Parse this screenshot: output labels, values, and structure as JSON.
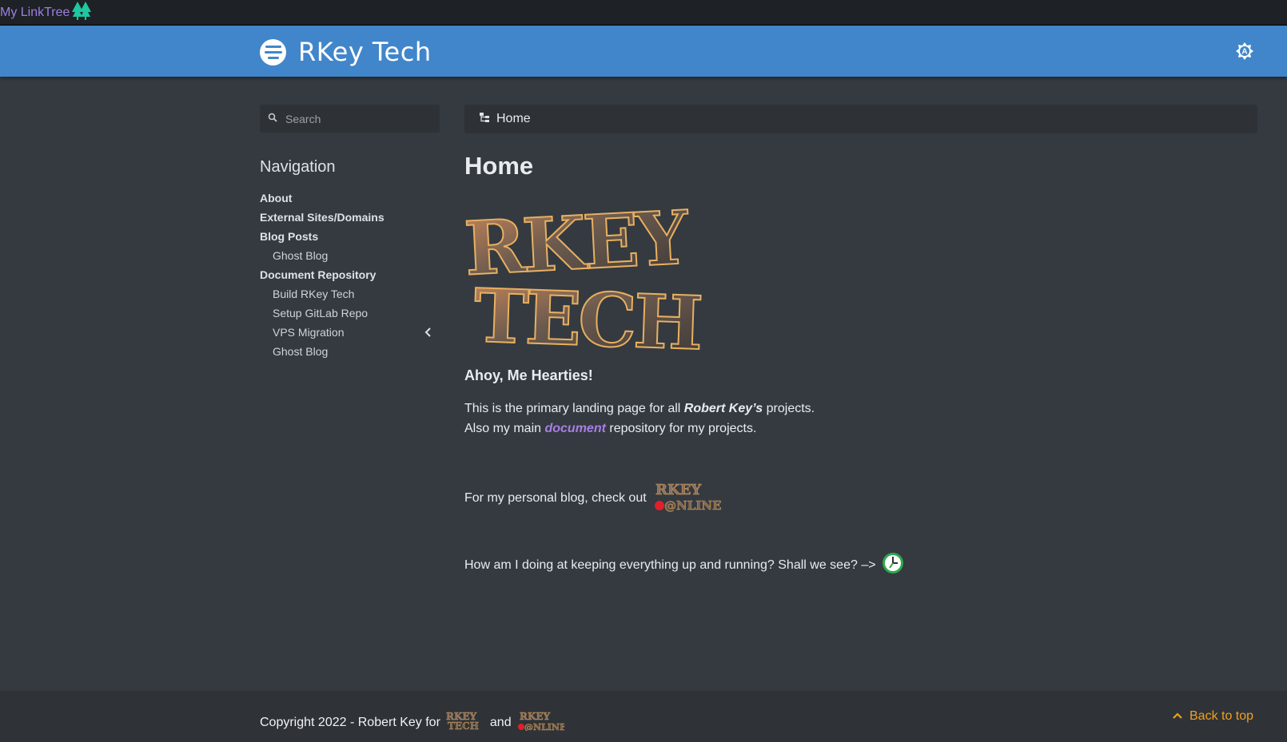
{
  "topbar": {
    "link_label": "My LinkTree",
    "link_icon": "tree-icon"
  },
  "header": {
    "title": "RKey Tech",
    "menu_icon": "menu-icon",
    "theme_icon": "theme-toggle-icon"
  },
  "search": {
    "placeholder": "Search"
  },
  "navigation": {
    "heading": "Navigation",
    "items": [
      {
        "label": "About",
        "level": 0
      },
      {
        "label": "External Sites/Domains",
        "level": 0
      },
      {
        "label": "Blog Posts",
        "level": 0
      },
      {
        "label": "Ghost Blog",
        "level": 1
      },
      {
        "label": "Document Repository",
        "level": 0
      },
      {
        "label": "Build RKey Tech",
        "level": 1
      },
      {
        "label": "Setup GitLab Repo",
        "level": 1
      },
      {
        "label": "VPS Migration",
        "level": 1
      },
      {
        "label": "Ghost Blog",
        "level": 1
      }
    ]
  },
  "breadcrumb": {
    "label": "Home"
  },
  "main": {
    "title": "Home",
    "logo_text": [
      "RKEY",
      "TECH"
    ],
    "greeting": "Ahoy, Me Hearties!",
    "intro_before": "This is the primary landing page for all ",
    "intro_name": "Robert Key’s",
    "intro_after": " projects.",
    "line2_before": "Also my main ",
    "line2_link": "document",
    "line2_after": " repository for my projects.",
    "blog_text": "For my personal blog, check out",
    "blog_logo_text": [
      "RKEY",
      "@NLINE"
    ],
    "status_text": "How am I doing at keeping everything up and running? Shall we see? –>"
  },
  "footer": {
    "copyright_prefix": "Copyright 2022 - Robert Key for",
    "and": "and",
    "back_to_top": "Back to top"
  },
  "colors": {
    "header": "#4186ca",
    "background": "#343a40",
    "link_purple": "#a87ee6",
    "back_to_top": "#f0a020",
    "topbar_link": "#9d7fe0",
    "tree_icon": "#1ec8a0"
  }
}
